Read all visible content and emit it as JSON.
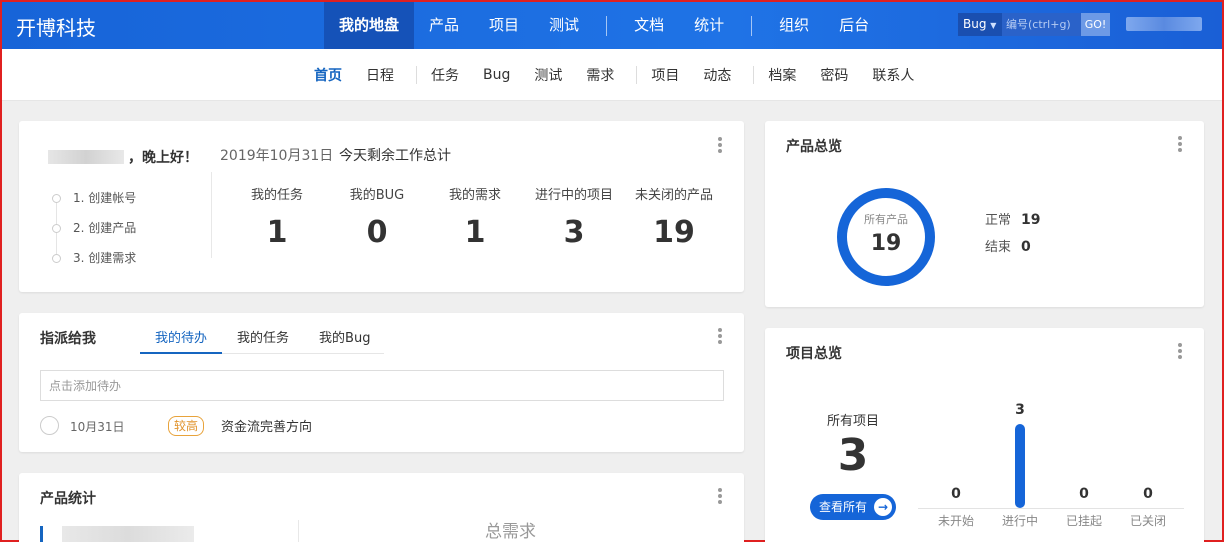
{
  "header": {
    "brand": "开博科技",
    "nav": [
      {
        "label": "我的地盘",
        "active": true
      },
      {
        "label": "产品"
      },
      {
        "label": "项目"
      },
      {
        "label": "测试"
      },
      {
        "sep": true
      },
      {
        "label": "文档"
      },
      {
        "label": "统计"
      },
      {
        "sep": true
      },
      {
        "label": "组织"
      },
      {
        "label": "后台"
      }
    ],
    "search": {
      "type": "Bug",
      "placeholder": "编号(ctrl+g)",
      "go": "GO!"
    }
  },
  "subnav": [
    {
      "label": "首页",
      "active": true
    },
    {
      "label": "日程"
    },
    {
      "sep": true
    },
    {
      "label": "任务"
    },
    {
      "label": "Bug"
    },
    {
      "label": "测试"
    },
    {
      "label": "需求"
    },
    {
      "sep": true
    },
    {
      "label": "项目"
    },
    {
      "label": "动态"
    },
    {
      "sep": true
    },
    {
      "label": "档案"
    },
    {
      "label": "密码"
    },
    {
      "label": "联系人"
    }
  ],
  "welcome": {
    "greeting": "，晚上好！",
    "date": "2019年10月31日",
    "summary": "今天剩余工作总计",
    "steps": [
      "1. 创建帐号",
      "2. 创建产品",
      "3. 创建需求"
    ],
    "stats": [
      {
        "label": "我的任务",
        "value": "1"
      },
      {
        "label": "我的BUG",
        "value": "0"
      },
      {
        "label": "我的需求",
        "value": "1"
      },
      {
        "label": "进行中的项目",
        "value": "3"
      },
      {
        "label": "未关闭的产品",
        "value": "19"
      }
    ]
  },
  "assigned": {
    "title": "指派给我",
    "tabs": [
      {
        "label": "我的待办",
        "active": true
      },
      {
        "label": "我的任务"
      },
      {
        "label": "我的Bug"
      }
    ],
    "todo_placeholder": "点击添加待办",
    "items": [
      {
        "date": "10月31日",
        "priority": "较高",
        "text": "资金流完善方向"
      }
    ]
  },
  "product_stats": {
    "title": "产品统计",
    "total_label": "总需求"
  },
  "product_overview": {
    "title": "产品总览",
    "ring_label": "所有产品",
    "ring_value": "19",
    "legend": [
      {
        "label": "正常",
        "value": "19"
      },
      {
        "label": "结束",
        "value": "0"
      }
    ]
  },
  "project_overview": {
    "title": "项目总览",
    "all_label": "所有项目",
    "all_value": "3",
    "view_all": "查看所有",
    "chart_data": {
      "type": "bar",
      "categories": [
        "未开始",
        "进行中",
        "已挂起",
        "已关闭"
      ],
      "values": [
        0,
        3,
        0,
        0
      ],
      "ylim": [
        0,
        3
      ]
    }
  },
  "colors": {
    "accent": "#1565d8",
    "header": "#1f73e6",
    "badge": "#e0922a"
  }
}
